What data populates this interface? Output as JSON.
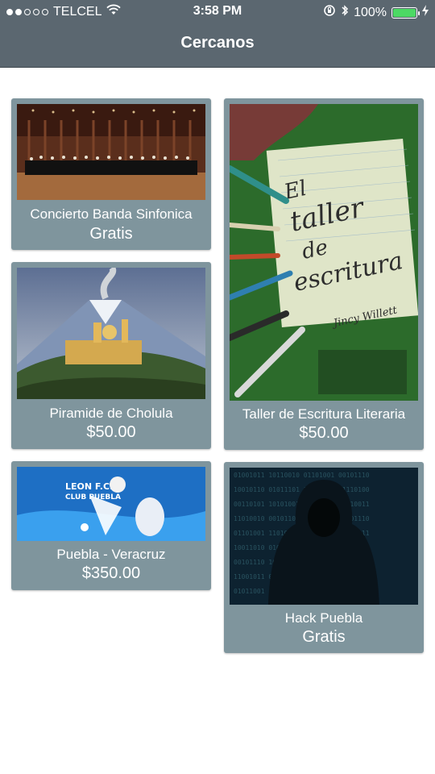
{
  "status": {
    "carrier": "TELCEL",
    "time": "3:58 PM",
    "battery": "100%"
  },
  "header": {
    "title": "Cercanos"
  },
  "cards": [
    {
      "name": "Concierto Banda Sinfonica",
      "price": "Gratis"
    },
    {
      "name": "Taller de Escritura Literaria",
      "price": "$50.00"
    },
    {
      "name": "Piramide de Cholula",
      "price": "$50.00"
    },
    {
      "name": "Puebla - Veracruz",
      "price": "$350.00"
    },
    {
      "name": "Hack Puebla",
      "price": "Gratis"
    }
  ],
  "images": {
    "book": {
      "line1": "El",
      "line2": "taller",
      "line3": "de",
      "line4": "escritura",
      "author": "Jincy Willett"
    },
    "poster": {
      "line1": "LEON F.C.",
      "line2": "CLUB PUEBLA"
    }
  }
}
